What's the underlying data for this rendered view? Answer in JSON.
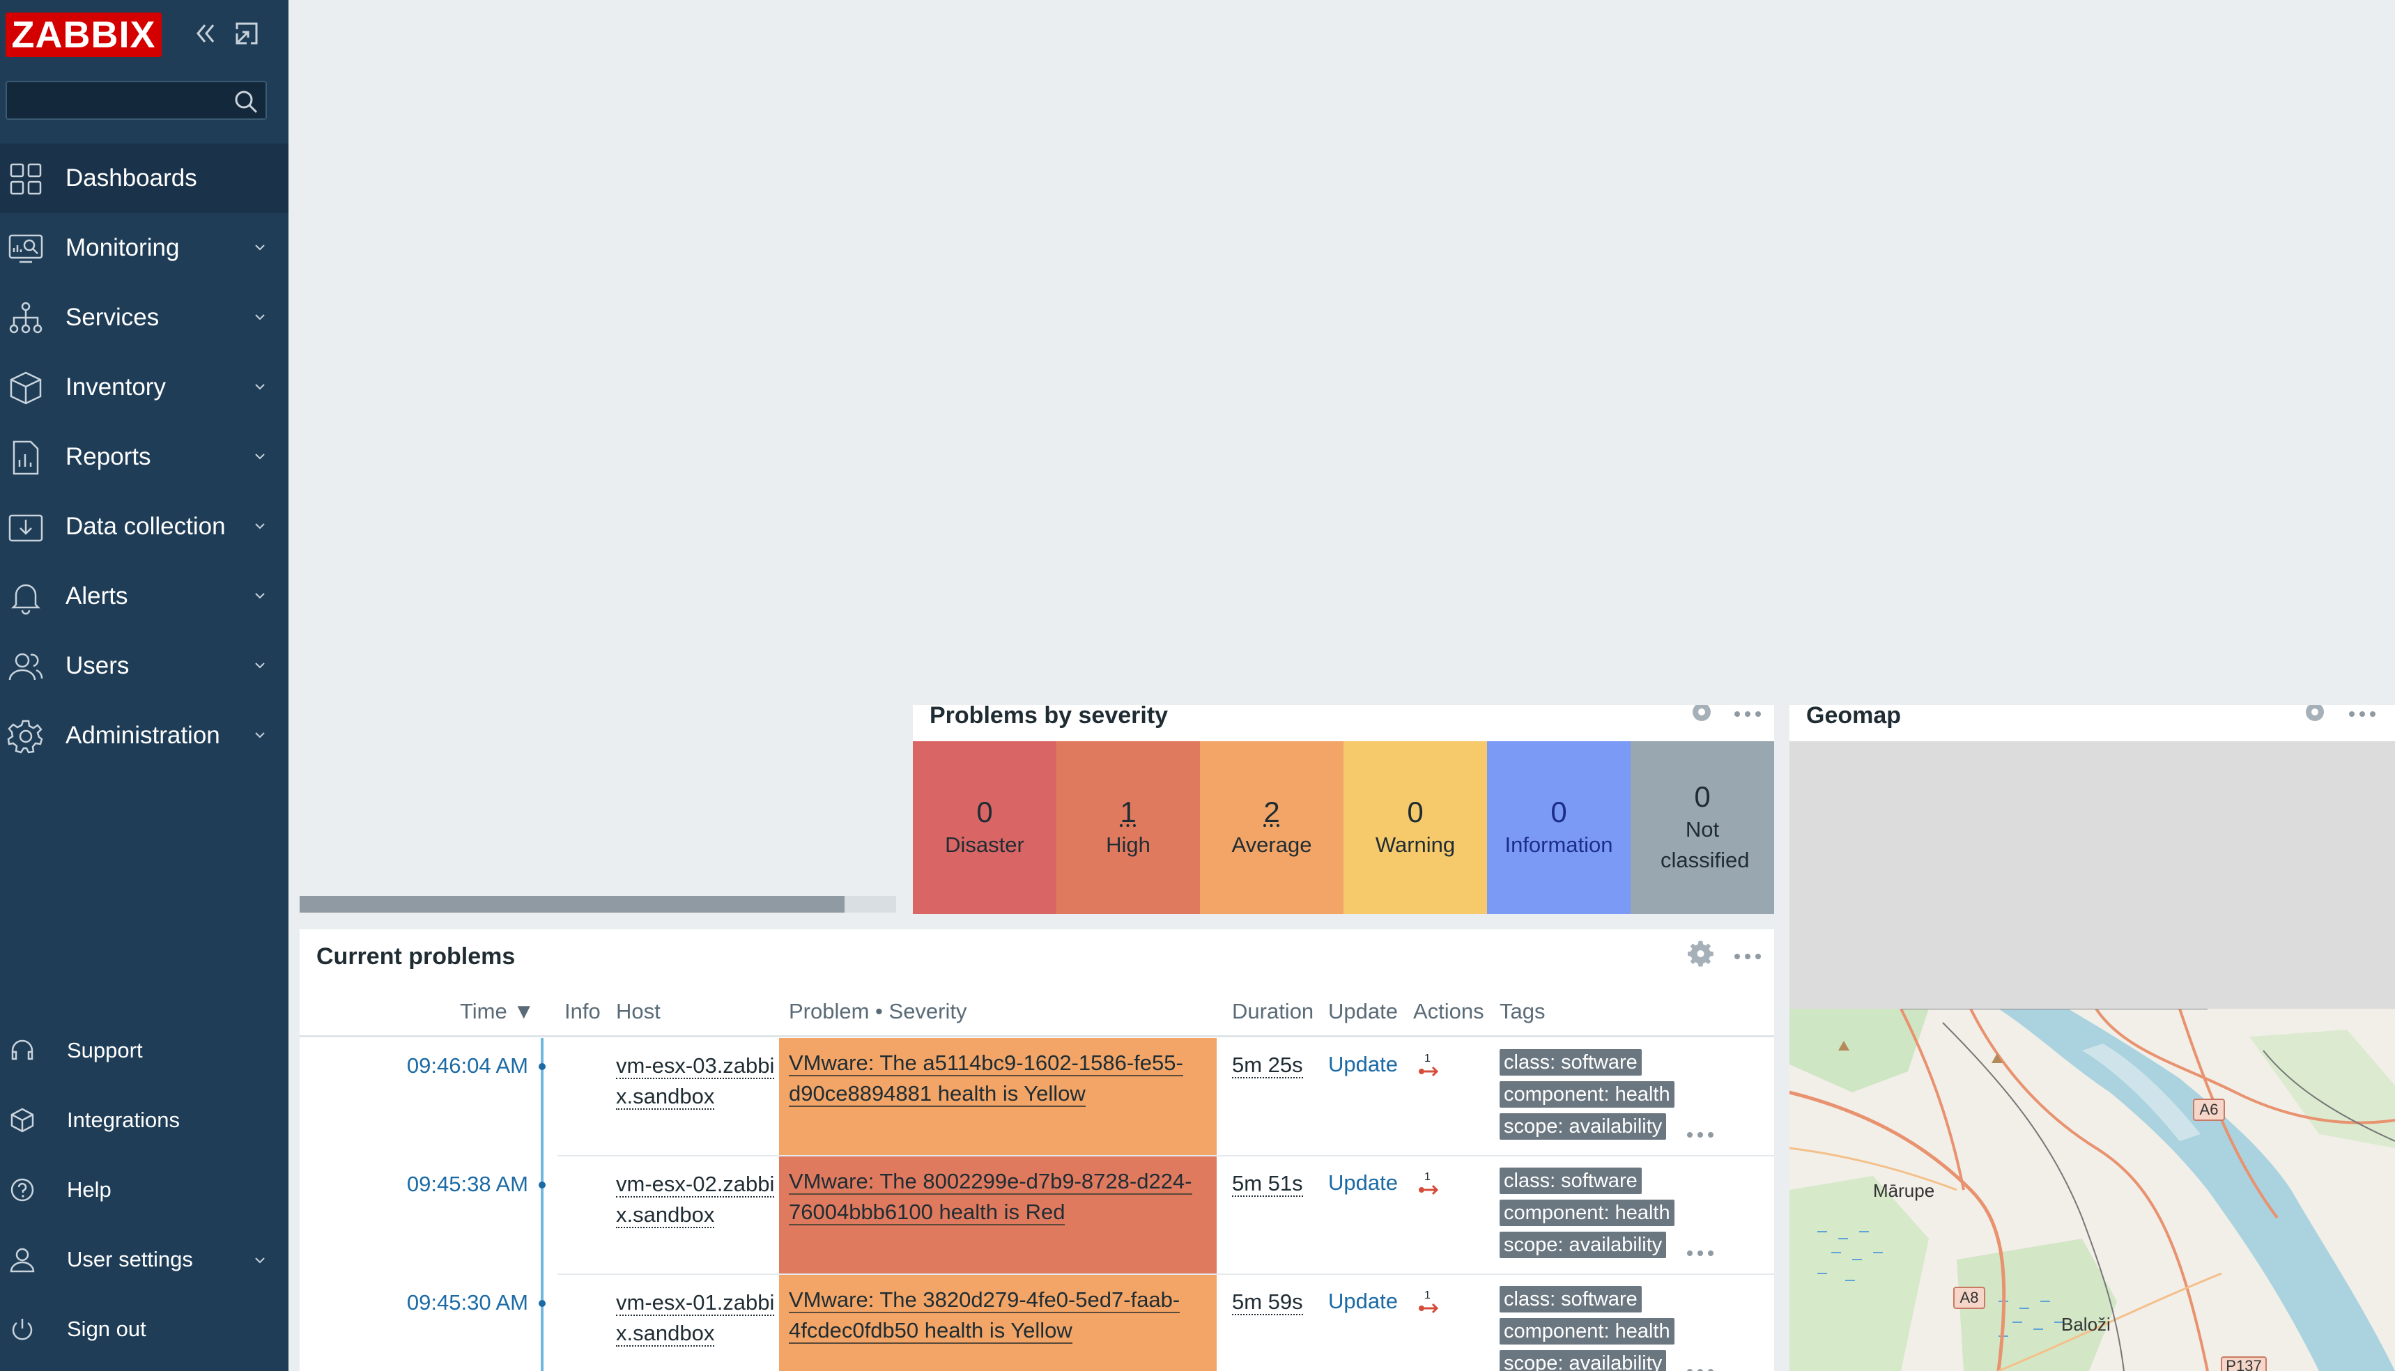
{
  "sidebar": {
    "logo": "ZABBIX",
    "search": {
      "value": "",
      "placeholder": ""
    },
    "nav": [
      {
        "label": "Dashboards",
        "icon": "dashboards-icon",
        "active": true
      },
      {
        "label": "Monitoring",
        "icon": "monitoring-icon"
      },
      {
        "label": "Services",
        "icon": "services-icon"
      },
      {
        "label": "Inventory",
        "icon": "inventory-icon"
      },
      {
        "label": "Reports",
        "icon": "reports-icon"
      },
      {
        "label": "Data collection",
        "icon": "data-collection-icon"
      },
      {
        "label": "Alerts",
        "icon": "alerts-icon"
      },
      {
        "label": "Users",
        "icon": "users-icon"
      },
      {
        "label": "Administration",
        "icon": "administration-icon"
      }
    ],
    "utilities": [
      {
        "label": "Support",
        "icon": "headset-icon"
      },
      {
        "label": "Integrations",
        "icon": "integrations-icon"
      },
      {
        "label": "Help",
        "icon": "help-icon"
      },
      {
        "label": "User settings",
        "icon": "user-icon"
      },
      {
        "label": "Sign out",
        "icon": "power-icon"
      }
    ]
  },
  "problems_by_severity": {
    "title": "Problems by severity",
    "cells": [
      {
        "count": "0",
        "label": "Disaster",
        "color": "#d96665"
      },
      {
        "count": "1",
        "label": "High",
        "color": "#e07a5f"
      },
      {
        "count": "2",
        "label": "Average",
        "color": "#f2a566"
      },
      {
        "count": "0",
        "label": "Warning",
        "color": "#f6c96b"
      },
      {
        "count": "0",
        "label": "Information",
        "color": "#7a9af5"
      },
      {
        "count": "0",
        "label": "Not classified",
        "color": "#99a7b1"
      }
    ]
  },
  "geomap": {
    "title": "Geomap",
    "labels": {
      "a6": "A6",
      "marupe": "Mārupe",
      "a8": "A8",
      "balozi": "Baloži",
      "p137": "P137"
    }
  },
  "current_problems": {
    "title": "Current problems",
    "columns": {
      "time": "Time ▼",
      "info": "Info",
      "host": "Host",
      "problem": "Problem • Severity",
      "duration": "Duration",
      "update": "Update",
      "actions": "Actions",
      "tags": "Tags"
    },
    "rows": [
      {
        "time": "09:46:04 AM",
        "host": "vm-esx-03.zabbix.sandbox",
        "problem": "VMware: The a5114bc9-1602-1586-fe55-d90ce8894881 health is Yellow",
        "severity_color": "#f2a566",
        "duration": "5m 25s",
        "update": "Update",
        "actions_count": "1",
        "tags": [
          "class: software",
          "component: health",
          "scope: availability"
        ]
      },
      {
        "time": "09:45:38 AM",
        "host": "vm-esx-02.zabbix.sandbox",
        "problem": "VMware: The 8002299e-d7b9-8728-d224-76004bbb6100 health is Red",
        "severity_color": "#e07a5f",
        "duration": "5m 51s",
        "update": "Update",
        "actions_count": "1",
        "tags": [
          "class: software",
          "component: health",
          "scope: availability"
        ]
      },
      {
        "time": "09:45:30 AM",
        "host": "vm-esx-01.zabbix.sandbox",
        "problem": "VMware: The 3820d279-4fe0-5ed7-faab-4fcdec0fdb50 health is Yellow",
        "severity_color": "#f2a566",
        "duration": "5m 59s",
        "update": "Update",
        "actions_count": "1",
        "tags": [
          "class: software",
          "component: health",
          "scope: availability"
        ]
      }
    ]
  }
}
